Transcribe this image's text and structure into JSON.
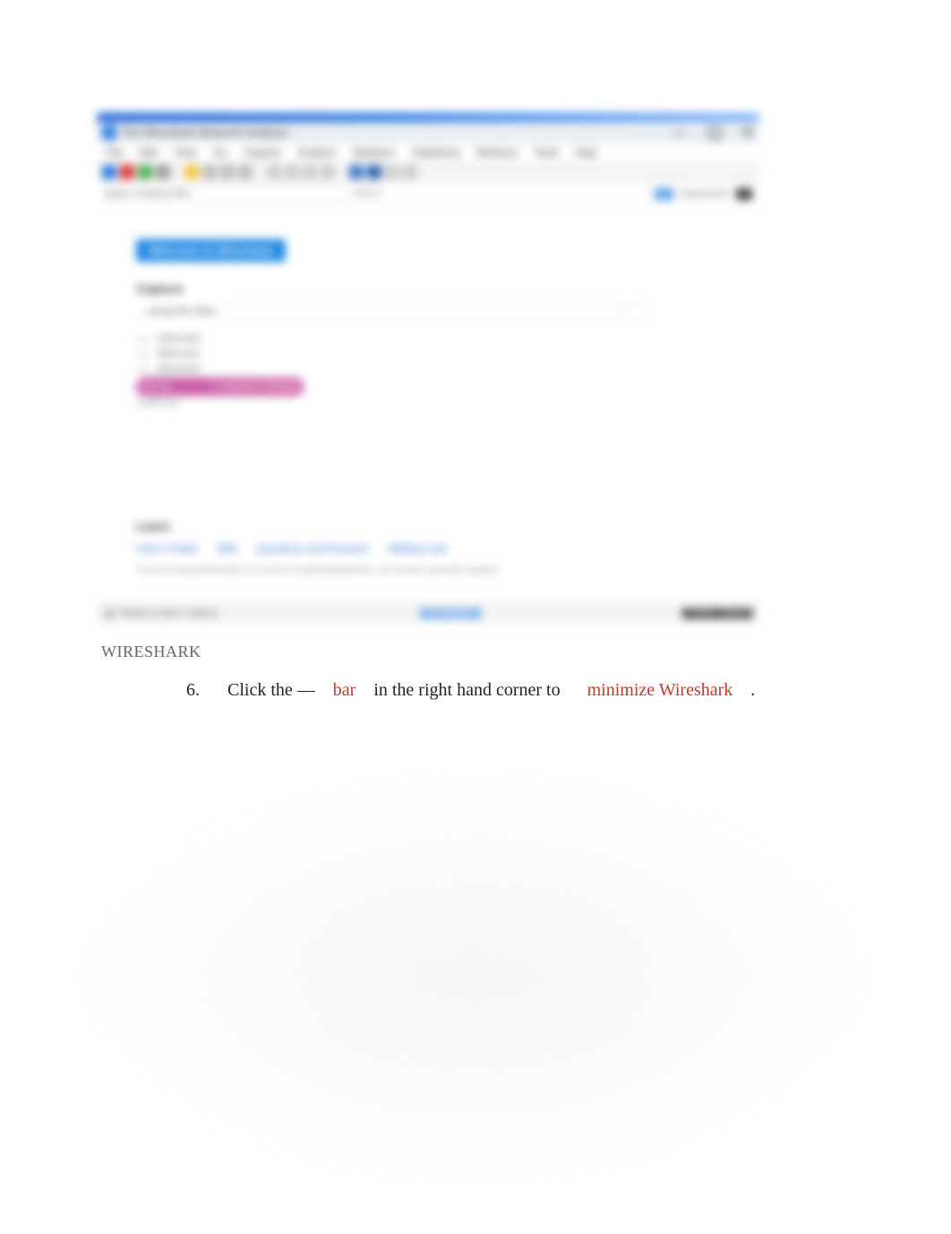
{
  "wireshark": {
    "app_name": "The Wireshark Network Analyzer",
    "menu": [
      "File",
      "Edit",
      "View",
      "Go",
      "Capture",
      "Analyze",
      "Statistics",
      "Telephony",
      "Wireless",
      "Tools",
      "Help"
    ],
    "filter": {
      "label": "Apply a display filter",
      "hint": "<Ctrl-/>",
      "expression": "Expression",
      "plus": "+"
    },
    "banner": "Welcome to Wireshark",
    "capture": {
      "heading": "Capture",
      "filter_label": "…using this filter:",
      "filter_placeholder": "Enter a capture filter …"
    },
    "interfaces": [
      {
        "name": "Ethernet0",
        "extra": ""
      },
      {
        "name": "Ethernet1",
        "extra": ""
      },
      {
        "name": "Ethernet2",
        "extra": ""
      },
      {
        "name": "Npcap",
        "extra": "Loopback Adapter"
      },
      {
        "name": "USBPcap1",
        "extra": ""
      }
    ],
    "learn": {
      "heading": "Learn",
      "links": [
        "User's Guide",
        "Wiki",
        "Questions and Answers",
        "Mailing Lists"
      ],
      "note": "You are running Wireshark 3.0.3 (v3.0.3-0-g6130b92b0ec6). You receive automatic updates."
    },
    "status": {
      "ready": "Ready to load or capture",
      "packets": "No Packets",
      "profile": "Profile: Default"
    }
  },
  "caption": "WIRESHARK",
  "step": {
    "number": "6.",
    "t1": "Click  the —",
    "red1": "bar",
    "t2": "in the right hand corner to",
    "red2": "minimize Wireshark",
    "t3": "."
  }
}
